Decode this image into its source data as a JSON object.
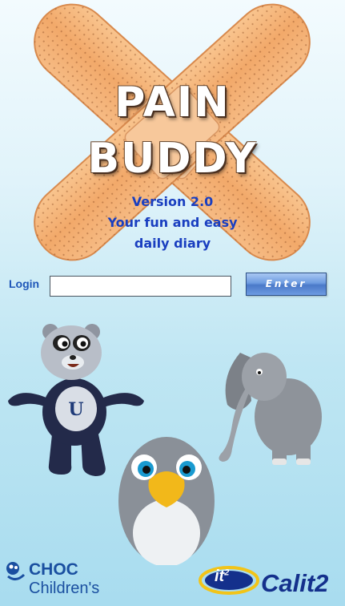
{
  "app": {
    "title_line1": "PAIN",
    "title_line2": "BUDDY",
    "version": "Version 2.0",
    "tagline_line1": "Your fun and easy",
    "tagline_line2": "daily diary"
  },
  "login": {
    "label": "Login",
    "input_value": "",
    "enter_label": "Enter"
  },
  "characters": [
    "panda",
    "elephant",
    "penguin"
  ],
  "logos": {
    "choc_line1": "CHOC",
    "choc_line2": "Children's",
    "calit_badge": "it",
    "calit_badge_sup": "2",
    "calit_name": "Calit2"
  },
  "colors": {
    "bandage": "#f4b27a",
    "tagline": "#1a3fc0",
    "login_label": "#1e56b8",
    "button": "#6d9be0",
    "choc_blue": "#1a4fa0",
    "calit_blue": "#14308c",
    "calit_yellow": "#f2c418"
  }
}
